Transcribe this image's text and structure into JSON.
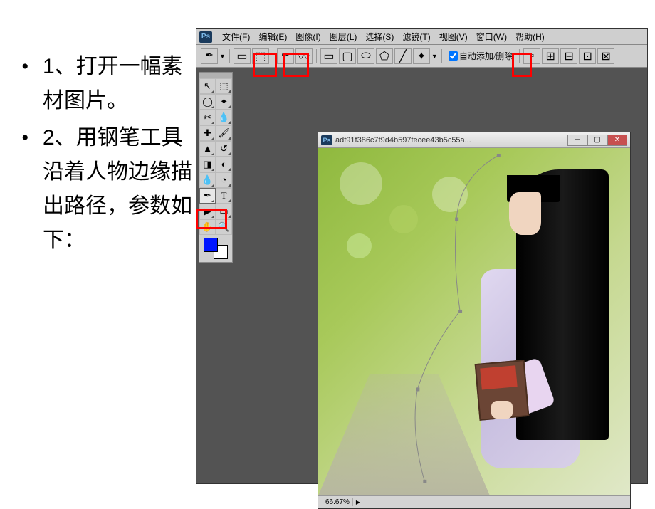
{
  "instructions": {
    "item1_num": "1",
    "item1_text": "、打开一幅素材图片。",
    "item2_num": "2",
    "item2_text": "、用钢笔工具沿着人物边缘描出路径，参数如下："
  },
  "ps": {
    "logo": "Ps",
    "menu": {
      "file": "文件",
      "file_k": "(F)",
      "edit": "编辑",
      "edit_k": "(E)",
      "image": "图像",
      "image_k": "(I)",
      "layer": "图层",
      "layer_k": "(L)",
      "select": "选择",
      "select_k": "(S)",
      "filter": "滤镜",
      "filter_k": "(T)",
      "view": "视图",
      "view_k": "(V)",
      "window": "窗口",
      "window_k": "(W)",
      "help": "帮助",
      "help_k": "(H)"
    },
    "options": {
      "auto_add_delete": "自动添加/删除"
    },
    "document": {
      "title": "adf91f386c7f9d4b597fecee43b5c55a...",
      "zoom": "66.67%"
    },
    "colors": {
      "foreground": "#0015ff",
      "background": "#ffffff"
    }
  }
}
